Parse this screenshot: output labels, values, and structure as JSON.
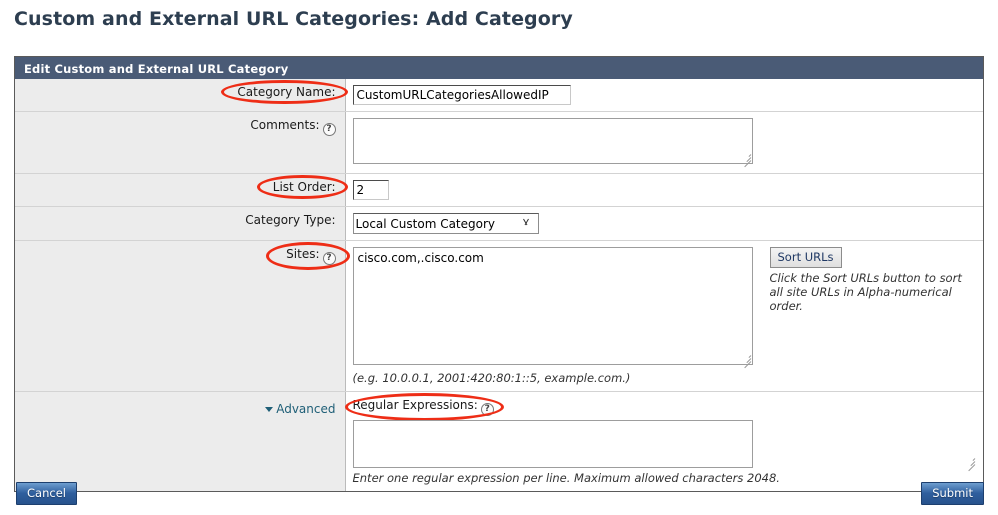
{
  "page": {
    "title": "Custom and External URL Categories: Add Category"
  },
  "panel": {
    "header": "Edit Custom and External URL Category"
  },
  "fields": {
    "category_name": {
      "label": "Category Name:",
      "value": "CustomURLCategoriesAllowedIP",
      "placeholder": ""
    },
    "comments": {
      "label": "Comments:",
      "value": "",
      "placeholder": "",
      "help_icon": "?"
    },
    "list_order": {
      "label": "List Order:",
      "value": "2",
      "placeholder": ""
    },
    "category_type": {
      "label": "Category Type:",
      "selected": "Local Custom Category",
      "options": [
        "Local Custom Category"
      ]
    },
    "sites": {
      "label": "Sites:",
      "value": "cisco.com,.cisco.com",
      "placeholder": "",
      "help_icon": "?",
      "example_note": "(e.g. 10.0.0.1, 2001:420:80:1::5, example.com.)",
      "sort_button": "Sort URLs",
      "sort_help": "Click the Sort URLs button to sort all site URLs in Alpha-numerical order."
    },
    "advanced": {
      "label": "Advanced",
      "toggle_icon": "chevron-down-icon"
    },
    "regular_expressions": {
      "label": "Regular Expressions:",
      "value": "",
      "placeholder": "",
      "help_icon": "?",
      "note": "Enter one regular expression per line. Maximum allowed characters 2048."
    }
  },
  "footer": {
    "cancel_label": "Cancel",
    "submit_label": "Submit"
  },
  "colors": {
    "header_bar": "#4a5b76",
    "title_text": "#2d3e50",
    "annotation": "#ee2d16",
    "button_blue": "#2f5f9e",
    "label_bg": "#ececec"
  }
}
